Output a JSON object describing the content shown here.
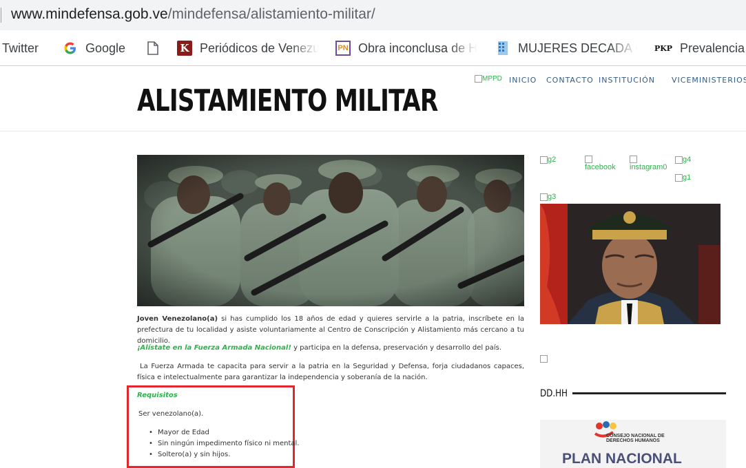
{
  "browser": {
    "url_host": "www.mindefensa.gob.ve",
    "url_path": "/mindefensa/alistamiento-militar/",
    "bookmarks": [
      {
        "label": "Twitter",
        "icon": "twitter-icon"
      },
      {
        "label": "Google",
        "icon": "google-icon"
      },
      {
        "label": "",
        "icon": "blank-page-icon"
      },
      {
        "label": "Periódicos de Venezu",
        "icon": "k-logo-icon"
      },
      {
        "label": "Obra inconclusa de H",
        "icon": "pn-logo-icon"
      },
      {
        "label": "MUJERES DECADA O",
        "icon": "grid-logo-icon"
      },
      {
        "label": "Prevalencia d",
        "icon": "pkp-logo-icon"
      }
    ]
  },
  "nav": {
    "mppd": "MPPD",
    "items": [
      "INICIO",
      "CONTACTO",
      "INSTITUCIÓN",
      "VICEMINISTERIOS"
    ]
  },
  "page": {
    "title": "ALISTAMIENTO MILITAR",
    "para1_bold": "Joven Venezolano(a)",
    "para1_rest": " si has cumplido los 18 años de edad y quieres servirle a la patria, inscríbete en la prefectura de tu localidad y asiste voluntariamente al Centro de Conscripción y Alistamiento más cercano a tu domicilio.",
    "para2_green": "¡Alístate en la Fuerza Armada Nacional!",
    "para2_rest": " y participa en la defensa, preservación y desarrollo del país.",
    "para3": "La Fuerza Armada te capacita para servir a la patria en la Seguridad y Defensa, forja ciudadanos capaces, física e intelectualmente para garantizar la independencia y soberanía de la nación.",
    "requisitos_title": "Requisitos",
    "requisitos_intro": "Ser venezolano(a).",
    "requisitos": [
      "Mayor de Edad",
      "Sin ningún impedimento físico ni mental.",
      "Soltero(a) y sin hijos."
    ]
  },
  "sidebar": {
    "links": [
      "g2",
      "facebook",
      "instagram0",
      "g4",
      "g1",
      "g3"
    ],
    "section_title": "DD.HH",
    "banner_org": "CONSEJO NACIONAL DE DERECHOS HUMANOS",
    "banner_plan": "PLAN NACIONAL"
  },
  "colors": {
    "link_green": "#2db34a",
    "nav_blue": "#2f5b8a",
    "highlight_red": "#e2262b"
  }
}
